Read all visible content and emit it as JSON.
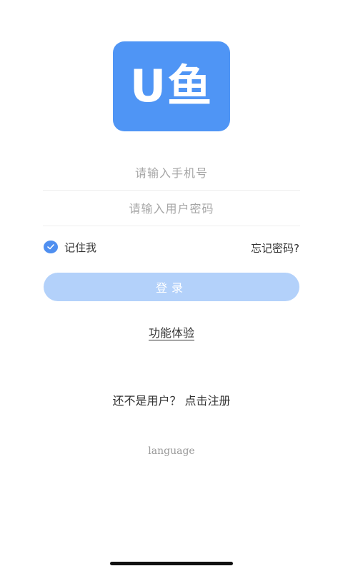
{
  "app": {
    "logo_text": "U鱼",
    "brand_color": "#4f95f5"
  },
  "form": {
    "phone_placeholder": "请输入手机号",
    "password_placeholder": "请输入用户密码",
    "remember_label": "记住我",
    "remember_checked": true,
    "forgot_label": "忘记密码?",
    "login_label": "登录",
    "login_button_color": "#b3d1fa"
  },
  "links": {
    "demo_label": "功能体验",
    "register_label": "还不是用户？ 点击注册",
    "language_label": "language"
  },
  "icons": {
    "check": "check-icon"
  }
}
